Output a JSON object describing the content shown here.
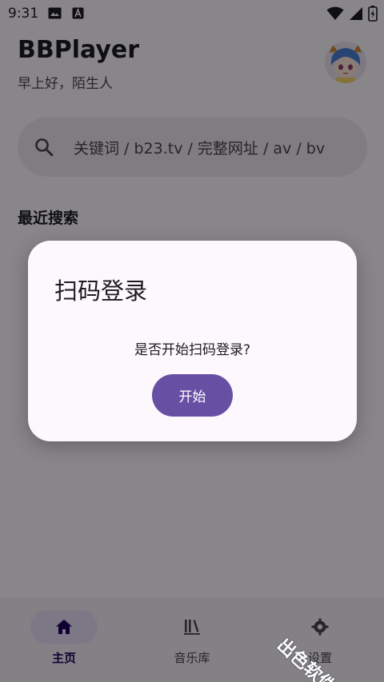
{
  "status_bar": {
    "time": "9:31",
    "icons": [
      "image-icon",
      "font-download-icon",
      "wifi-icon",
      "cell-signal-icon",
      "battery-charging-icon"
    ]
  },
  "header": {
    "title": "BBPlayer",
    "greeting": "早上好，陌生人",
    "avatar": "avatar-anime-character"
  },
  "search": {
    "placeholder": "关键词 / b23.tv / 完整网址 / av / bv"
  },
  "recent": {
    "title": "最近搜索"
  },
  "dialog": {
    "title": "扫码登录",
    "message": "是否开始扫码登录?",
    "confirm_label": "开始"
  },
  "bottom_nav": {
    "items": [
      {
        "label": "主页",
        "icon": "home-icon",
        "active": true
      },
      {
        "label": "音乐库",
        "icon": "library-icon",
        "active": false
      },
      {
        "label": "设置",
        "icon": "settings-icon",
        "active": false
      }
    ]
  },
  "watermark": "出色软件站",
  "colors": {
    "accent": "#6750a4",
    "scrim": "#000000",
    "surface": "#fdf8fd",
    "search_bg": "#ece6f0",
    "active_indicator": "#e8def8"
  }
}
